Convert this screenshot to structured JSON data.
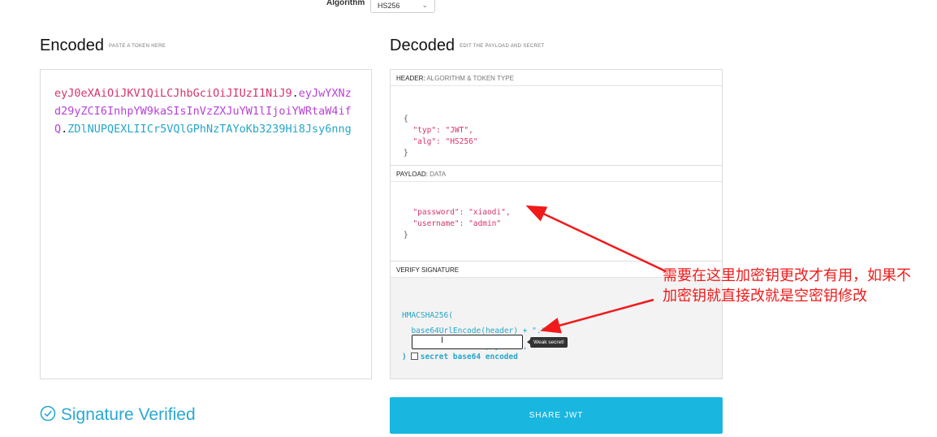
{
  "header": {
    "algorithm_label": "Algorithm",
    "algorithm_value": "HS256"
  },
  "encoded": {
    "title": "Encoded",
    "subtitle": "PASTE A TOKEN HERE",
    "token_header": "eyJ0eXAiOiJKV1QiLCJhbGciOiJIUzI1NiJ9",
    "token_payload": "eyJwYXNzd29yZCI6InhpYW9kaSIsInVzZXJuYW1lIjoiYWRtaW4ifQ",
    "token_signature": "ZDlNUPQEXLIICr5VQlGPhNzTAYoKb3239Hi8Jsy6nng",
    "dot": "."
  },
  "decoded": {
    "title": "Decoded",
    "subtitle": "EDIT THE PAYLOAD AND SECRET",
    "header_section": {
      "label": "HEADER:",
      "sublabel": "ALGORITHM & TOKEN TYPE",
      "line1": "{",
      "line2": "  \"typ\": \"JWT\",",
      "line3": "  \"alg\": \"HS256\"",
      "line4": "}"
    },
    "payload_section": {
      "label": "PAYLOAD:",
      "sublabel": "DATA",
      "line1": "  \"password\": \"xiaodi\",",
      "line2": "  \"username\": \"admin\"",
      "line3": "}"
    },
    "signature_section": {
      "label": "VERIFY SIGNATURE",
      "line1": "HMACSHA256(",
      "line2": "  base64UrlEncode(header) + \".\" +",
      "line3": "  base64UrlEncode(payload),",
      "secret_value": "",
      "weak_badge": "Weak secret!",
      "close_paren": ")",
      "b64_label": "secret base64 encoded",
      "b64_checked": false
    }
  },
  "footer": {
    "verified_icon": "check-circle-icon",
    "verified_text": "Signature Verified",
    "share_button": "SHARE JWT"
  },
  "annotation": {
    "text": "需要在这里加密钥更改才有用，如果不加密钥就直接改就是空密钥修改",
    "color": "#f01a1a"
  },
  "colors": {
    "header_part": "#d6336c",
    "payload_part": "#b743d6",
    "signature_part": "#26a6c9",
    "share_button": "#19b7e0"
  }
}
